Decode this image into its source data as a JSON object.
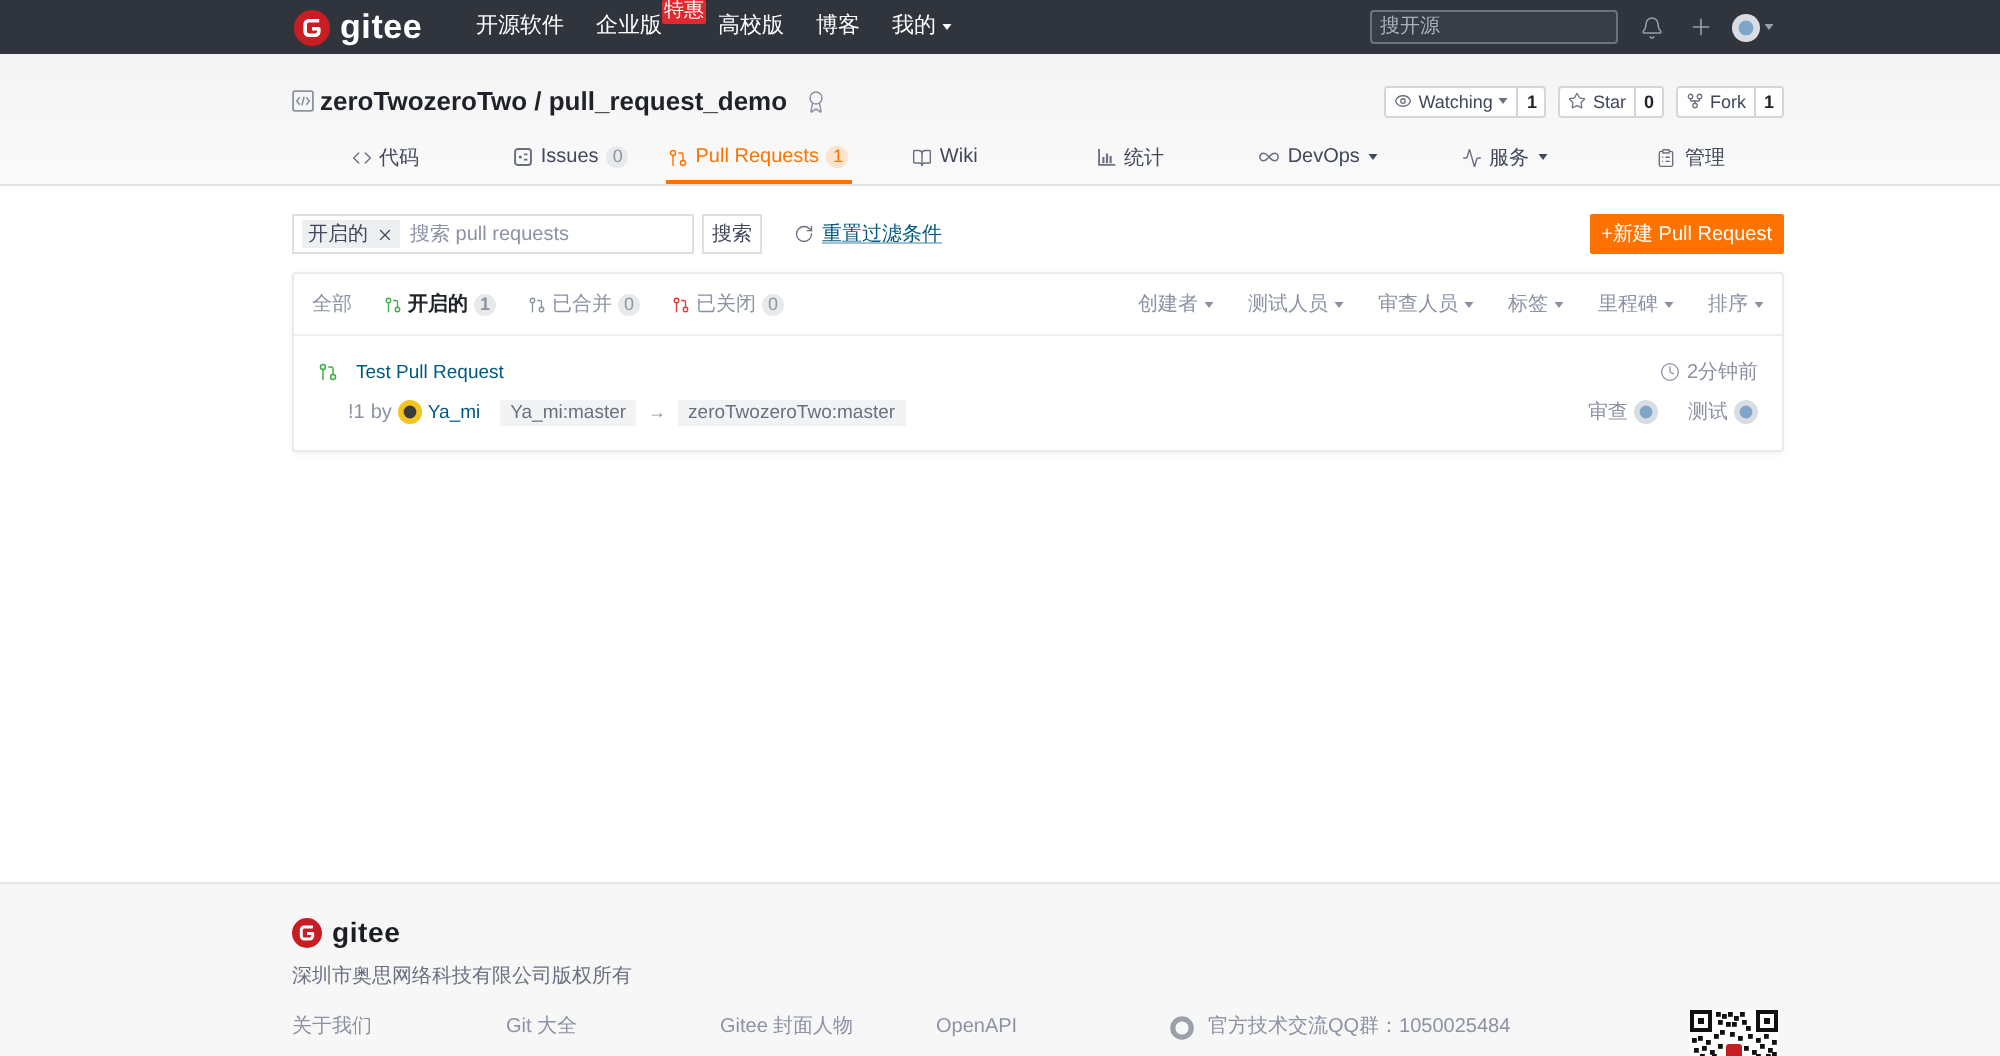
{
  "top_nav": {
    "brand": "gitee",
    "items": [
      {
        "label": "开源软件",
        "dropdown": false
      },
      {
        "label": "企业版",
        "badge": "特惠",
        "dropdown": false
      },
      {
        "label": "高校版",
        "dropdown": false
      },
      {
        "label": "博客",
        "dropdown": false
      },
      {
        "label": "我的",
        "dropdown": true
      }
    ],
    "search": {
      "placeholder": "搜开源"
    }
  },
  "repo": {
    "title": "zeroTwozeroTwo / pull_request_demo",
    "actions": [
      {
        "kind": "watch",
        "label": "Watching",
        "count": "1",
        "dropdown": true
      },
      {
        "kind": "star",
        "label": "Star",
        "count": "0",
        "dropdown": false
      },
      {
        "kind": "fork",
        "label": "Fork",
        "count": "1",
        "dropdown": false
      }
    ]
  },
  "tabs": [
    {
      "kind": "code",
      "label": "代码",
      "selected": false,
      "dropdown": false
    },
    {
      "kind": "issues",
      "label": "Issues",
      "count": "0",
      "selected": false,
      "dropdown": false
    },
    {
      "kind": "pulls",
      "label": "Pull Requests",
      "count": "1",
      "selected": true,
      "dropdown": false
    },
    {
      "kind": "wiki",
      "label": "Wiki",
      "selected": false,
      "dropdown": false
    },
    {
      "kind": "stats",
      "label": "统计",
      "selected": false,
      "dropdown": false
    },
    {
      "kind": "devops",
      "label": "DevOps",
      "selected": false,
      "dropdown": true
    },
    {
      "kind": "services",
      "label": "服务",
      "selected": false,
      "dropdown": true
    },
    {
      "kind": "manage",
      "label": "管理",
      "selected": false,
      "dropdown": false
    }
  ],
  "filter_bar": {
    "chip": "开启的",
    "placeholder": "搜索 pull requests",
    "search_button": "搜索",
    "reset_link": "重置过滤条件",
    "new_button": "+新建 Pull Request"
  },
  "state_tabs": [
    {
      "kind": "all",
      "label": "全部",
      "selected": false
    },
    {
      "kind": "open",
      "label": "开启的",
      "count": "1",
      "selected": true
    },
    {
      "kind": "merged",
      "label": "已合并",
      "count": "0",
      "selected": false
    },
    {
      "kind": "closed",
      "label": "已关闭",
      "count": "0",
      "selected": false
    }
  ],
  "filters": [
    "创建者",
    "测试人员",
    "审查人员",
    "标签",
    "里程碑",
    "排序"
  ],
  "pull_requests": [
    {
      "kind": "open",
      "title": "Test Pull Request",
      "time": "2分钟前",
      "number": "!1",
      "by": "by",
      "author": "Ya_mi",
      "source_branch": "Ya_mi:master",
      "arrow": "→",
      "target_branch": "zeroTwozeroTwo:master",
      "reviewers_label": "审查",
      "testers_label": "测试"
    }
  ],
  "footer": {
    "brand": "gitee",
    "copyright": "深圳市奥思网络科技有限公司版权所有",
    "links": [
      "关于我们",
      "Git 大全",
      "Gitee 封面人物",
      "OpenAPI"
    ],
    "contact": "官方技术交流QQ群：1050025484"
  }
}
